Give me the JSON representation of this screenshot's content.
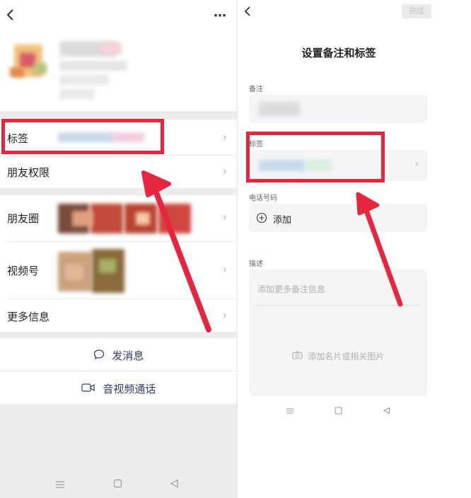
{
  "left": {
    "more_icon": "more-icon",
    "rows": {
      "tags": "标签",
      "friend_permission": "朋友权限",
      "moments": "朋友圈",
      "channels": "视频号",
      "more_info": "更多信息"
    },
    "actions": {
      "send_message": "发消息",
      "video_call": "音视频通话"
    }
  },
  "right": {
    "done_label": "完成",
    "title": "设置备注和标签",
    "remark_label": "备注",
    "tag_label": "标签",
    "phone_label": "电话号码",
    "add_label": "添加",
    "description_label": "描述",
    "description_placeholder": "添加更多备注信息",
    "photo_placeholder": "添加名片或相关图片"
  },
  "colors": {
    "highlight_red": "#e6263f",
    "band_gray": "#ededed",
    "field_gray": "#f5f5f5"
  }
}
